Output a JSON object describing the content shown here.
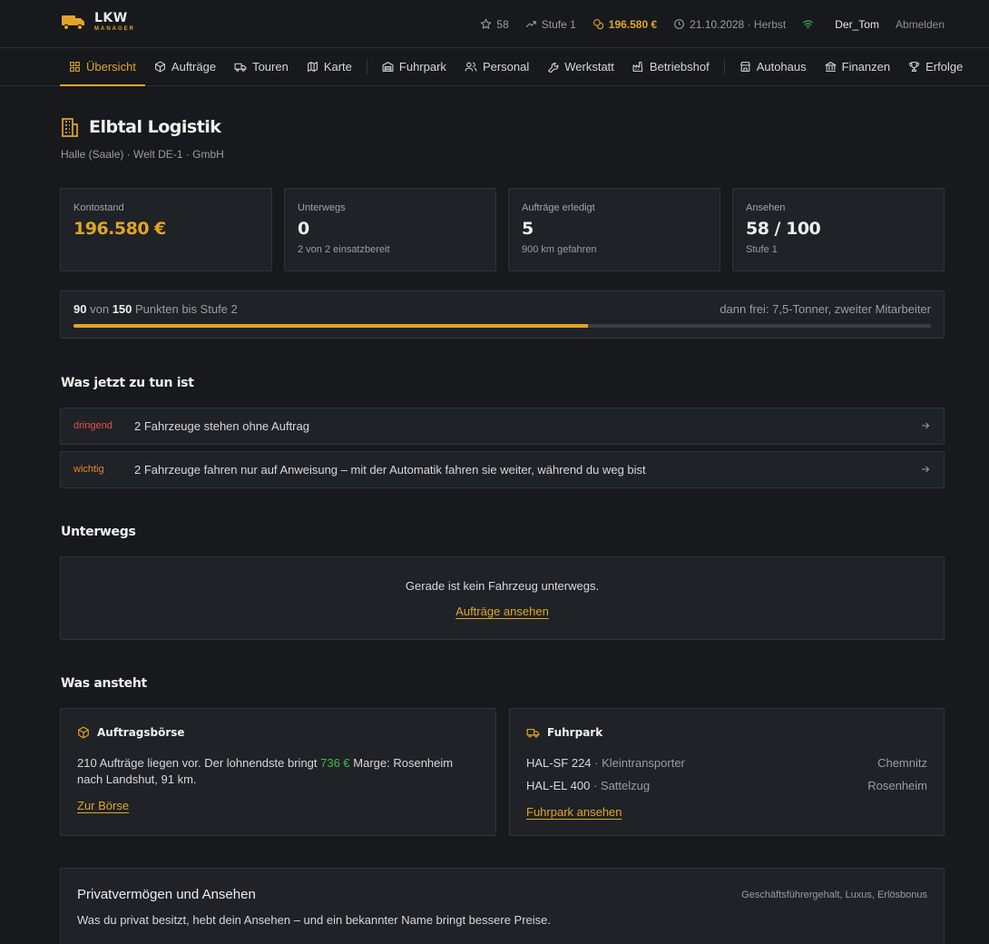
{
  "brand": {
    "name": "LKW",
    "sub": "MANAGER",
    "accent": "#e0a526"
  },
  "topbar": {
    "stars": "58",
    "level": "Stufe 1",
    "balance": "196.580 €",
    "date": "21.10.2028",
    "season": "· Herbst",
    "user": "Der_Tom",
    "logout": "Abmelden"
  },
  "nav": {
    "items": [
      {
        "label": "Übersicht",
        "icon": "grid-icon",
        "active": true
      },
      {
        "label": "Aufträge",
        "icon": "box-icon"
      },
      {
        "label": "Touren",
        "icon": "truck-icon"
      },
      {
        "label": "Karte",
        "icon": "map-icon"
      },
      {
        "label": "Fuhrpark",
        "icon": "garage-icon"
      },
      {
        "label": "Personal",
        "icon": "people-icon"
      },
      {
        "label": "Werkstatt",
        "icon": "wrench-icon"
      },
      {
        "label": "Betriebshof",
        "icon": "factory-icon"
      },
      {
        "label": "Autohaus",
        "icon": "store-icon"
      },
      {
        "label": "Finanzen",
        "icon": "bank-icon"
      },
      {
        "label": "Erfolge",
        "icon": "trophy-icon"
      }
    ]
  },
  "company": {
    "name": "Elbtal Logistik",
    "subtitle": "Halle (Saale) · Welt DE-1 · GmbH"
  },
  "stats": [
    {
      "label": "Kontostand",
      "value": "196.580 €",
      "sub": ""
    },
    {
      "label": "Unterwegs",
      "value": "0",
      "sub": "2 von 2 einsatzbereit"
    },
    {
      "label": "Aufträge erledigt",
      "value": "5",
      "sub": "900 km gefahren"
    },
    {
      "label": "Ansehen",
      "value": "58 / 100",
      "sub": "Stufe 1"
    }
  ],
  "progress": {
    "current": "90",
    "of": "von",
    "total": "150",
    "suffix": "Punkten bis Stufe 2",
    "unlock": "dann frei: 7,5-Tonner, zweiter Mitarbeiter",
    "fraction": 0.6
  },
  "todo": {
    "title": "Was jetzt zu tun ist",
    "items": [
      {
        "tag": "dringend",
        "text": "2 Fahrzeuge stehen ohne Auftrag",
        "color": "#e5534b"
      },
      {
        "tag": "wichtig",
        "text": "2 Fahrzeuge fahren nur auf Anweisung – mit der Automatik fahren sie weiter, während du weg bist",
        "color": "#e08a26"
      }
    ]
  },
  "underway": {
    "title": "Unterwegs",
    "empty": "Gerade ist kein Fahrzeug unterwegs.",
    "link": "Aufträge ansehen"
  },
  "upcoming": {
    "title": "Was ansteht",
    "market": {
      "title": "Auftragsbörse",
      "text_before": "210 Aufträge liegen vor. Der lohnendste bringt ",
      "amount": "736 €",
      "text_after": " Marge: Rosenheim nach Landshut, 91 km.",
      "link": "Zur Börse"
    },
    "fleet": {
      "title": "Fuhrpark",
      "vehicles": [
        {
          "plate": "HAL-SF 224",
          "type": "· Kleintransporter",
          "location": "Chemnitz"
        },
        {
          "plate": "HAL-EL 400",
          "type": "· Sattelzug",
          "location": "Rosenheim"
        }
      ],
      "link": "Fuhrpark ansehen"
    }
  },
  "private": {
    "title": "Privatvermögen und Ansehen",
    "tags": "Geschäftsführergehalt, Luxus, Erlösbonus",
    "text": "Was du privat besitzt, hebt dein Ansehen – und ein bekannter Name bringt bessere Preise."
  }
}
